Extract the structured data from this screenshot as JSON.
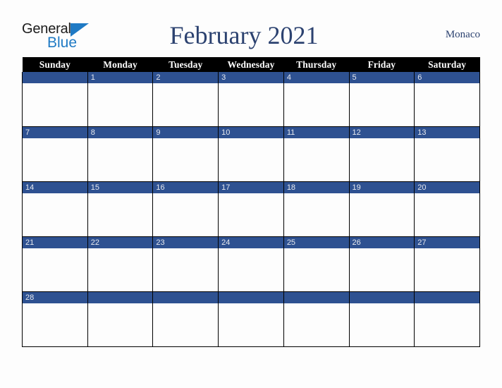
{
  "brand": {
    "name_part1": "General",
    "name_part2": "Blue",
    "accent_color": "#1f7ac4",
    "triangle_icon": "brand-triangle-icon"
  },
  "header": {
    "title": "February 2021",
    "locale": "Monaco",
    "title_color": "#2c4270"
  },
  "calendar": {
    "month": "February",
    "year": "2021",
    "weekday_headers": [
      "Sunday",
      "Monday",
      "Tuesday",
      "Wednesday",
      "Thursday",
      "Friday",
      "Saturday"
    ],
    "header_bg": "#000000",
    "header_fg": "#ffffff",
    "day_strip_bg": "#2e5191",
    "day_strip_fg": "#e8eaf0",
    "weeks": [
      [
        "",
        "1",
        "2",
        "3",
        "4",
        "5",
        "6"
      ],
      [
        "7",
        "8",
        "9",
        "10",
        "11",
        "12",
        "13"
      ],
      [
        "14",
        "15",
        "16",
        "17",
        "18",
        "19",
        "20"
      ],
      [
        "21",
        "22",
        "23",
        "24",
        "25",
        "26",
        "27"
      ],
      [
        "28",
        "",
        "",
        "",
        "",
        "",
        ""
      ]
    ]
  }
}
